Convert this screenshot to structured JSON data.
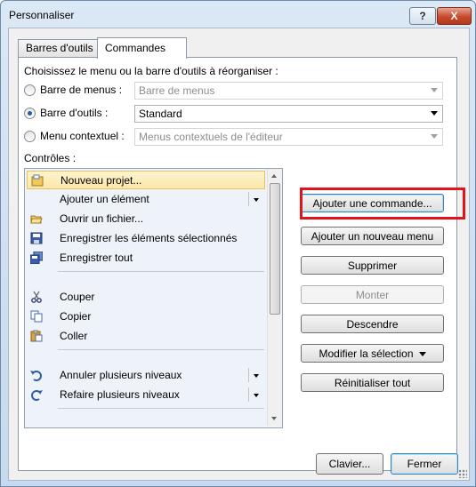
{
  "window": {
    "title": "Personnaliser",
    "help_label": "?",
    "close_label": "X"
  },
  "tabs": [
    {
      "label": "Barres d'outils"
    },
    {
      "label": "Commandes"
    }
  ],
  "intro": "Choisissez le menu ou la barre d'outils à réorganiser :",
  "choices": [
    {
      "label": "Barre de menus :",
      "value": "Barre de menus",
      "selected": false,
      "enabled": false
    },
    {
      "label": "Barre d'outils :",
      "value": "Standard",
      "selected": true,
      "enabled": true
    },
    {
      "label": "Menu contextuel :",
      "value": "Menus contextuels de l'éditeur",
      "selected": false,
      "enabled": false
    }
  ],
  "controls_label": "Contrôles :",
  "controls": [
    {
      "label": "Nouveau projet...",
      "icon": "new-project-icon",
      "selected": true
    },
    {
      "label": "Ajouter un élément",
      "icon": "",
      "submenu": true
    },
    {
      "label": "Ouvrir un fichier...",
      "icon": "open-folder-icon"
    },
    {
      "label": "Enregistrer les éléments sélectionnés",
      "icon": "save-icon"
    },
    {
      "label": "Enregistrer tout",
      "icon": "save-all-icon"
    },
    {
      "label": "Couper",
      "icon": "scissors-icon"
    },
    {
      "label": "Copier",
      "icon": "copy-icon"
    },
    {
      "label": "Coller",
      "icon": "paste-icon"
    },
    {
      "label": "Annuler plusieurs niveaux",
      "icon": "undo-icon",
      "submenu": true
    },
    {
      "label": "Refaire plusieurs niveaux",
      "icon": "redo-icon",
      "submenu": true
    }
  ],
  "buttons": {
    "add_command": "Ajouter une commande...",
    "add_menu": "Ajouter un nouveau menu",
    "delete": "Supprimer",
    "move_up": "Monter",
    "move_down": "Descendre",
    "modify": "Modifier la sélection",
    "reset": "Réinitialiser tout"
  },
  "footer": {
    "keyboard": "Clavier...",
    "close": "Fermer"
  },
  "colors": {
    "highlight": "#e3131c",
    "selection": "#fbe7a8",
    "close_button": "#c74a2f"
  }
}
